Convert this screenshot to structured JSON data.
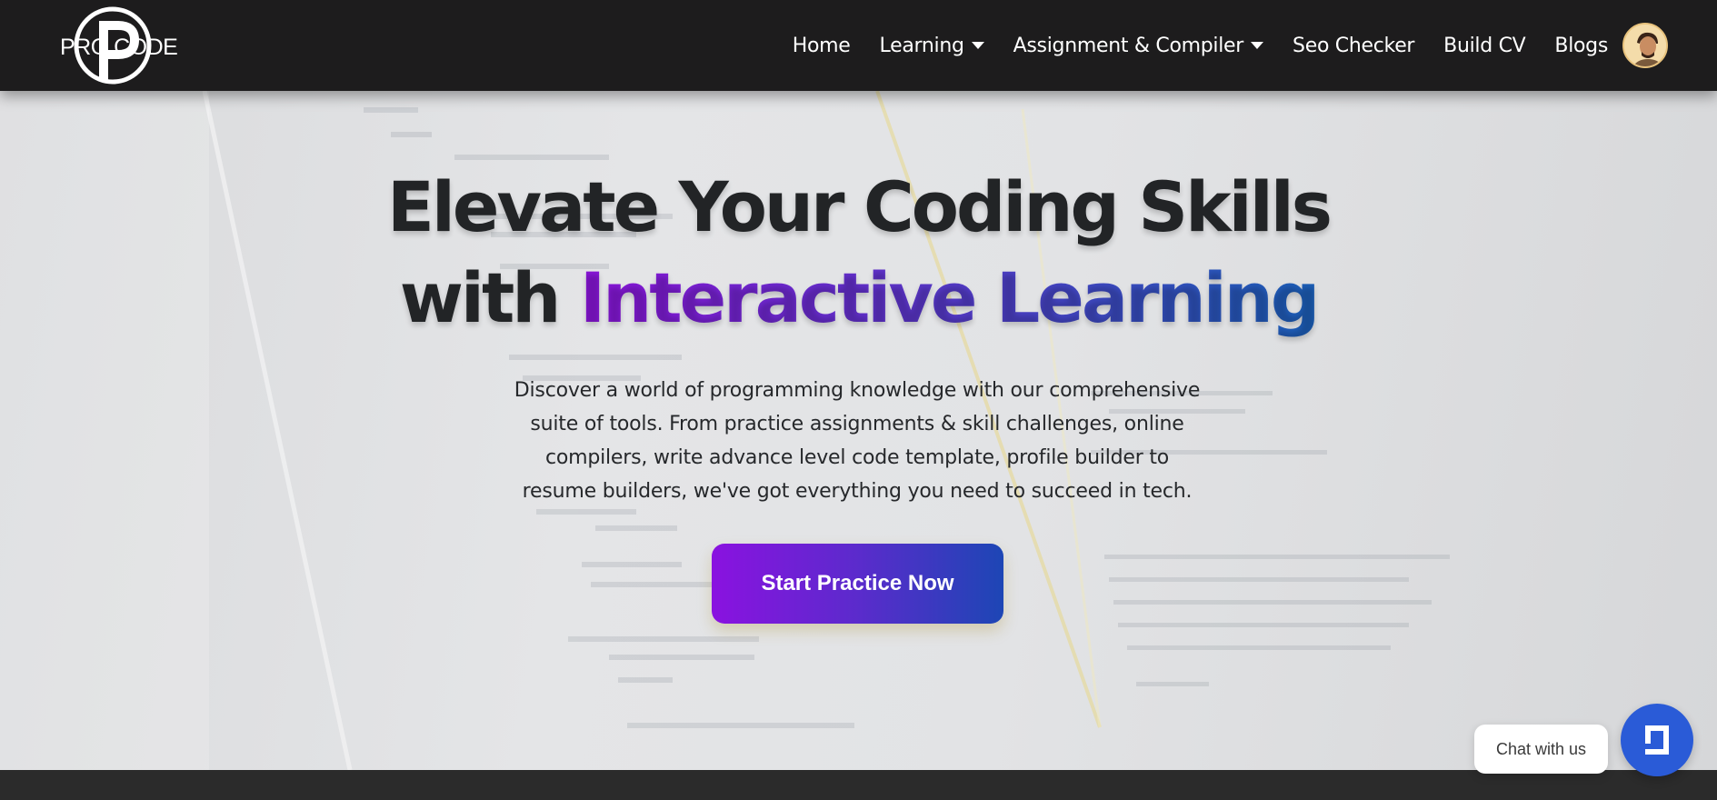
{
  "navbar": {
    "logo_text": "PRO CODE",
    "items": [
      {
        "label": "Home",
        "has_dropdown": false
      },
      {
        "label": "Learning",
        "has_dropdown": true
      },
      {
        "label": "Assignment & Compiler",
        "has_dropdown": true
      },
      {
        "label": "Seo Checker",
        "has_dropdown": false
      },
      {
        "label": "Build CV",
        "has_dropdown": false
      },
      {
        "label": "Blogs",
        "has_dropdown": false
      }
    ],
    "avatar_icon": "user-avatar"
  },
  "hero": {
    "headline_line1": "Elevate Your Coding Skills",
    "headline_line2_prefix": "with ",
    "headline_line2_highlight": "Interactive Learning",
    "subtext": "Discover a world of programming knowledge with our comprehensive suite of tools. From practice assignments & skill challenges, online compilers, write advance level code template, profile builder to resume builders, we've got everything you need to succeed in tech.",
    "cta_label": "Start Practice Now"
  },
  "chat": {
    "label": "Chat with us",
    "icon": "chat-icon"
  },
  "colors": {
    "navbar_bg": "#1d1c1d",
    "gradient_start": "#8a14d8",
    "gradient_end": "#1b5fb7",
    "chat_button": "#2a5bd7"
  }
}
